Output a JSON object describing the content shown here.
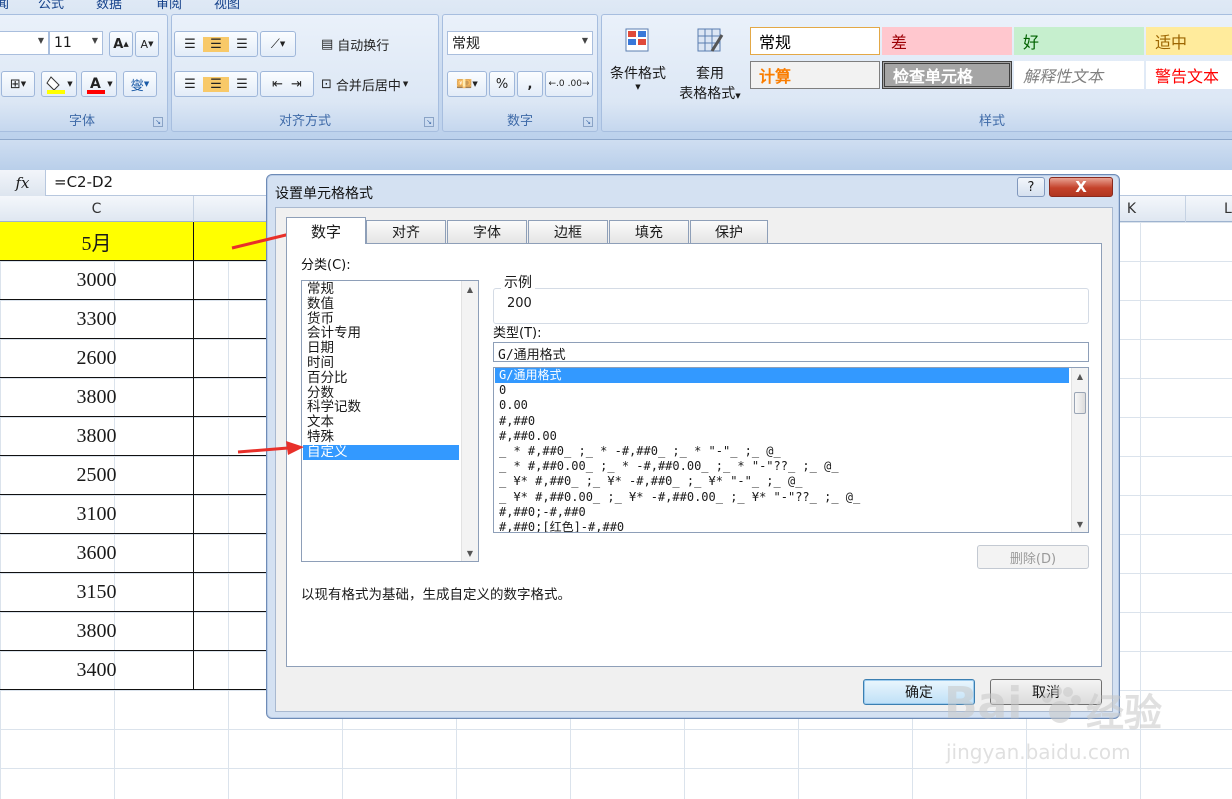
{
  "menubar": [
    "闻",
    "公式",
    "数据",
    "审阅",
    "视图"
  ],
  "font_group": {
    "size": "11",
    "grow_label": "A",
    "shrink_label": "A",
    "label": "字体",
    "wen_label": "燮"
  },
  "align_group": {
    "wrap_label": "自动换行",
    "merge_label": "合并后居中",
    "label": "对齐方式"
  },
  "number_group": {
    "format": "常规",
    "percent": "%",
    "comma": ",",
    "label": "数字"
  },
  "styles_group": {
    "cond_format": "条件格式",
    "table_format_1": "套用",
    "table_format_2": "表格格式",
    "label": "样式",
    "styles": [
      {
        "name": "常规",
        "bg": "#ffffff",
        "color": "#000000",
        "border": "#e3a846"
      },
      {
        "name": "差",
        "bg": "#ffc7ce",
        "color": "#9c0006",
        "border": "#ffc7ce"
      },
      {
        "name": "好",
        "bg": "#c6efce",
        "color": "#006100",
        "border": "#c6efce"
      },
      {
        "name": "适中",
        "bg": "#ffeb9c",
        "color": "#9c6500",
        "border": "#ffeb9c"
      },
      {
        "name": "计算",
        "bg": "#f2f2f2",
        "color": "#fa7d00",
        "border": "#7f7f7f"
      },
      {
        "name": "检查单元格",
        "bg": "#a5a5a5",
        "color": "#ffffff",
        "border": "#3f3f3f"
      },
      {
        "name": "解释性文本",
        "bg": "#ffffff",
        "color": "#7f7f7f",
        "border": "#ffffff"
      },
      {
        "name": "警告文本",
        "bg": "#ffffff",
        "color": "#ff0000",
        "border": "#ffffff"
      }
    ]
  },
  "formula": {
    "fx": "fx",
    "text": "=C2-D2"
  },
  "columns": {
    "c": "C",
    "k": "K",
    "l": "L"
  },
  "sheet": {
    "header_cell": "5月",
    "values": [
      "3000",
      "3300",
      "2600",
      "3800",
      "3800",
      "2500",
      "3100",
      "3600",
      "3150",
      "3800",
      "3400"
    ]
  },
  "dialog": {
    "title": "设置单元格格式",
    "help": "?",
    "close": "X",
    "tabs": [
      "数字",
      "对齐",
      "字体",
      "边框",
      "填充",
      "保护"
    ],
    "category_label": "分类(C):",
    "categories": [
      "常规",
      "数值",
      "货币",
      "会计专用",
      "日期",
      "时间",
      "百分比",
      "分数",
      "科学记数",
      "文本",
      "特殊",
      "自定义"
    ],
    "selected_category": "自定义",
    "sample_label": "示例",
    "sample_value": "200",
    "type_label": "类型(T):",
    "type_value": "G/通用格式",
    "formats": [
      "G/通用格式",
      "0",
      "0.00",
      "#,##0",
      "#,##0.00",
      "_ * #,##0_ ;_ * -#,##0_ ;_ * \"-\"_ ;_ @_",
      "_ * #,##0.00_ ;_ * -#,##0.00_ ;_ * \"-\"??_ ;_ @_",
      "_ ¥* #,##0_ ;_ ¥* -#,##0_ ;_ ¥* \"-\"_ ;_ @_",
      "_ ¥* #,##0.00_ ;_ ¥* -#,##0.00_ ;_ ¥* \"-\"??_ ;_ @_",
      "#,##0;-#,##0",
      "#,##0;[红色]-#,##0"
    ],
    "delete_label": "删除(D)",
    "description": "以现有格式为基础，生成自定义的数字格式。",
    "ok_label": "确定",
    "cancel_label": "取消"
  },
  "watermark": {
    "brand": "Bai",
    "brand_suffix": "经验",
    "url": "jingyan.baidu.com"
  },
  "colors": {
    "header_fill": "#ffff00",
    "selection": "#3399ff",
    "annotation_arrow": "#e8302a"
  }
}
